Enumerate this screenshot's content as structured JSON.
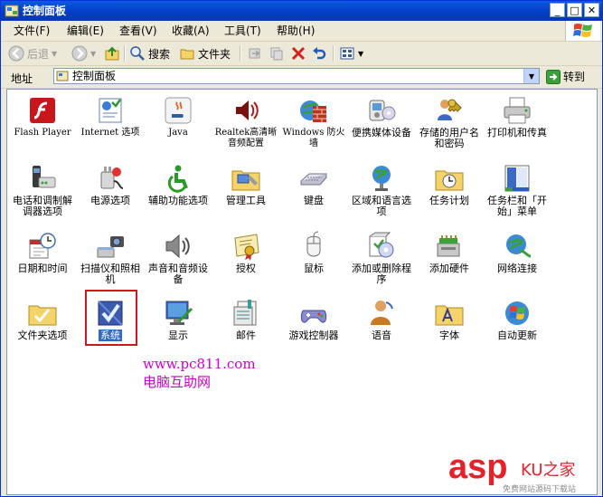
{
  "window": {
    "title": "控制面板"
  },
  "menu": [
    {
      "label": "文件(F)"
    },
    {
      "label": "编辑(E)"
    },
    {
      "label": "查看(V)"
    },
    {
      "label": "收藏(A)"
    },
    {
      "label": "工具(T)"
    },
    {
      "label": "帮助(H)"
    }
  ],
  "toolbar": {
    "back": "后退",
    "search": "搜索",
    "folders": "文件夹"
  },
  "address": {
    "label": "地址",
    "value": "控制面板",
    "go": "转到"
  },
  "items": [
    {
      "label": "Flash Player",
      "icon": "flash-icon"
    },
    {
      "label": "Internet 选项",
      "icon": "internet-options-icon"
    },
    {
      "label": "Java",
      "icon": "java-icon"
    },
    {
      "label": "Realtek高清晰音频配置",
      "icon": "realtek-audio-icon"
    },
    {
      "label": "Windows 防火墙",
      "icon": "firewall-icon"
    },
    {
      "label": "便携媒体设备",
      "icon": "portable-media-icon"
    },
    {
      "label": "存储的用户名和密码",
      "icon": "stored-passwords-icon"
    },
    {
      "label": "打印机和传真",
      "icon": "printer-icon"
    },
    {
      "label": "电话和调制解调器选项",
      "icon": "phone-modem-icon"
    },
    {
      "label": "电源选项",
      "icon": "power-icon"
    },
    {
      "label": "辅助功能选项",
      "icon": "accessibility-icon"
    },
    {
      "label": "管理工具",
      "icon": "admin-tools-icon"
    },
    {
      "label": "键盘",
      "icon": "keyboard-icon"
    },
    {
      "label": "区域和语言选项",
      "icon": "region-language-icon"
    },
    {
      "label": "任务计划",
      "icon": "scheduled-tasks-icon"
    },
    {
      "label": "任务栏和「开始」菜单",
      "icon": "taskbar-start-icon"
    },
    {
      "label": "日期和时间",
      "icon": "date-time-icon"
    },
    {
      "label": "扫描仪和照相机",
      "icon": "scanner-camera-icon"
    },
    {
      "label": "声音和音频设备",
      "icon": "sound-icon"
    },
    {
      "label": "授权",
      "icon": "license-icon"
    },
    {
      "label": "鼠标",
      "icon": "mouse-icon"
    },
    {
      "label": "添加或删除程序",
      "icon": "add-remove-programs-icon"
    },
    {
      "label": "添加硬件",
      "icon": "add-hardware-icon"
    },
    {
      "label": "网络连接",
      "icon": "network-icon"
    },
    {
      "label": "文件夹选项",
      "icon": "folder-options-icon"
    },
    {
      "label": "系统",
      "icon": "system-icon"
    },
    {
      "label": "显示",
      "icon": "display-icon"
    },
    {
      "label": "邮件",
      "icon": "mail-icon"
    },
    {
      "label": "游戏控制器",
      "icon": "game-controller-icon"
    },
    {
      "label": "语音",
      "icon": "speech-icon"
    },
    {
      "label": "字体",
      "icon": "fonts-icon"
    },
    {
      "label": "自动更新",
      "icon": "auto-update-icon"
    }
  ],
  "selected_item": "系统",
  "watermark": {
    "url": "www.pc811.com",
    "name": "电脑互助网",
    "brand": "asp",
    "brand_cn": "KU之家",
    "brand_sub": "免费网站源码下载站"
  },
  "colors": {
    "titlebar": "#0a5be0",
    "selection": "#316ac5",
    "highlight_box": "#d01818",
    "watermark": "#cc00cc",
    "brand_red": "#e8202a"
  }
}
